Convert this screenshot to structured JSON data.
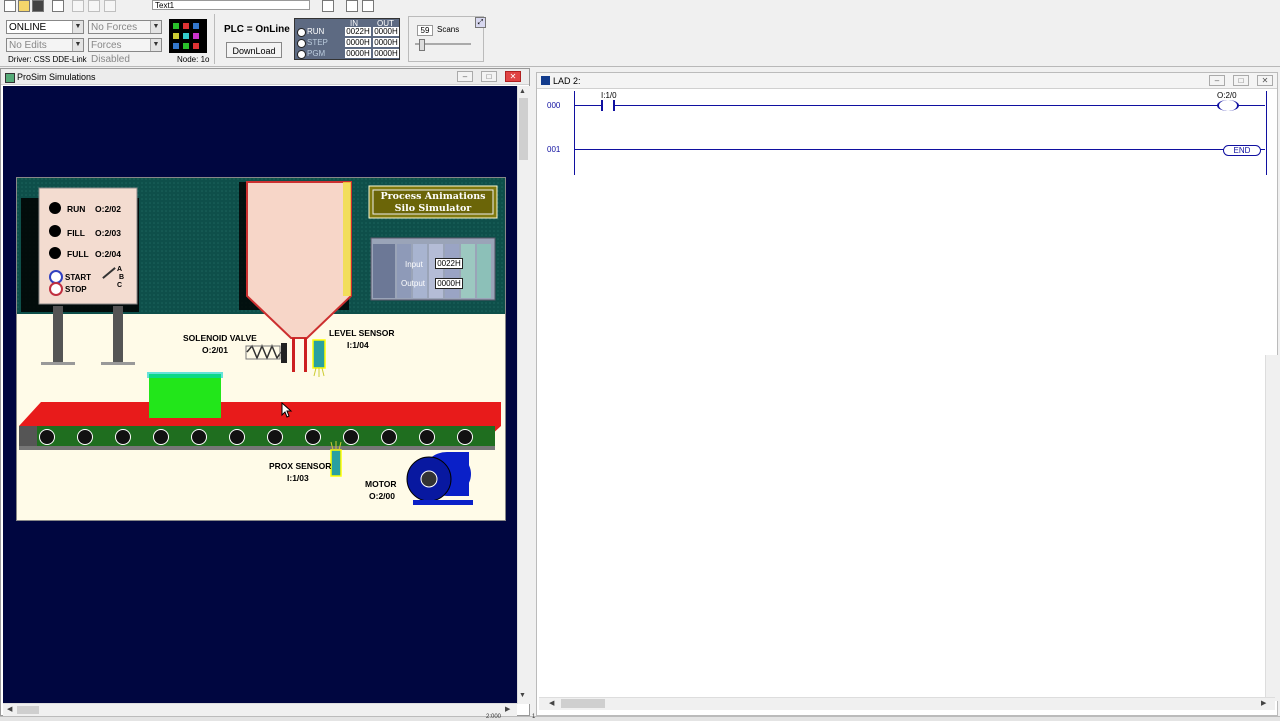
{
  "toolbar": {
    "text_field": "Text1"
  },
  "plc_panel": {
    "mode_select": "ONLINE",
    "forces_select": "No Forces",
    "edits_select": "No Edits",
    "forces_disabled_select": "Forces Disabled",
    "driver": "Driver: CSS DDE-Link",
    "node": "Node: 1o",
    "plc_status": "PLC = OnLine",
    "download_label": "DownLoad",
    "io_header_in": "IN",
    "io_header_out": "OUT",
    "modes": [
      {
        "label": "RUN",
        "in": "0022H",
        "out": "0000H"
      },
      {
        "label": "STEP",
        "in": "0000H",
        "out": "0000H"
      },
      {
        "label": "PGM",
        "in": "0000H",
        "out": "0000H"
      }
    ],
    "scans_value": "59",
    "scans_label": "Scans"
  },
  "sim_window": {
    "title": "ProSim Simulations",
    "run_label": "RUN",
    "run_addr": "O:2/02",
    "fill_label": "FILL",
    "fill_addr": "O:2/03",
    "full_label": "FULL",
    "full_addr": "O:2/04",
    "start_label": "START",
    "stop_label": "STOP",
    "abc_a": "A",
    "abc_b": "B",
    "abc_c": "C",
    "banner_line1": "Process Animations",
    "banner_line2": "Silo Simulator",
    "input_label": "Input",
    "input_value": "0022H",
    "output_label": "Output",
    "output_value": "0000H",
    "solenoid_label": "SOLENOID VALVE",
    "solenoid_addr": "O:2/01",
    "level_label": "LEVEL SENSOR",
    "level_addr": "I:1/04",
    "prox_label": "PROX SENSOR",
    "prox_addr": "I:1/03",
    "motor_label": "MOTOR",
    "motor_addr": "O:2/00"
  },
  "lad_window": {
    "title": "LAD 2:",
    "rungs": [
      {
        "number": "000",
        "contact": "I:1/0",
        "coil": "O:2/0"
      },
      {
        "number": "001",
        "end_label": "END"
      }
    ]
  },
  "status_bar": {
    "coord": "2:000",
    "mark": "1"
  },
  "colors": {
    "sim_bg": "#000640",
    "panel_teal": "#0e4f4a",
    "silo": "#f7d6c8",
    "conveyor": "#e81b1b",
    "box": "#22e61a",
    "motor": "#0a20c8"
  }
}
